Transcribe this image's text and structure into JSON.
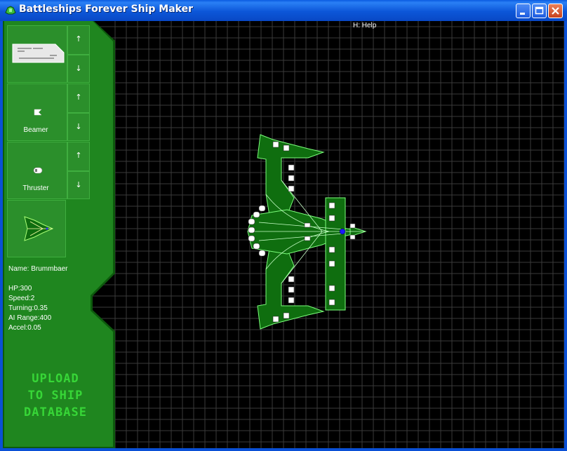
{
  "window": {
    "title": "Battleships Forever Ship Maker",
    "controls": [
      "minimize",
      "maximize",
      "close"
    ]
  },
  "help_hint": "H: Help",
  "palette": {
    "items": [
      {
        "label": "",
        "icon": "hull-section-icon"
      },
      {
        "label": "Beamer",
        "icon": "beamer-icon"
      },
      {
        "label": "Thruster",
        "icon": "thruster-icon"
      }
    ],
    "up_arrow": "↑",
    "down_arrow": "↓",
    "preview_icon": "ship-preview-icon"
  },
  "ship_stats": {
    "name": "Name: Brummbaer",
    "hp": "HP:300",
    "speed": "Speed:2",
    "turning": "Turning:0.35",
    "ai_range": "AI Range:400",
    "accel": "Accel:0.05"
  },
  "upload_button": {
    "line1": "UPLOAD",
    "line2": "TO SHIP",
    "line3": "DATABASE"
  },
  "colors": {
    "sidebar_green": "#218a21",
    "sidebar_dark": "#0d5a0d",
    "grid_line": "#3a3a3a",
    "ship_outline": "#7cff7c",
    "title_bar": "#0a55dc"
  }
}
